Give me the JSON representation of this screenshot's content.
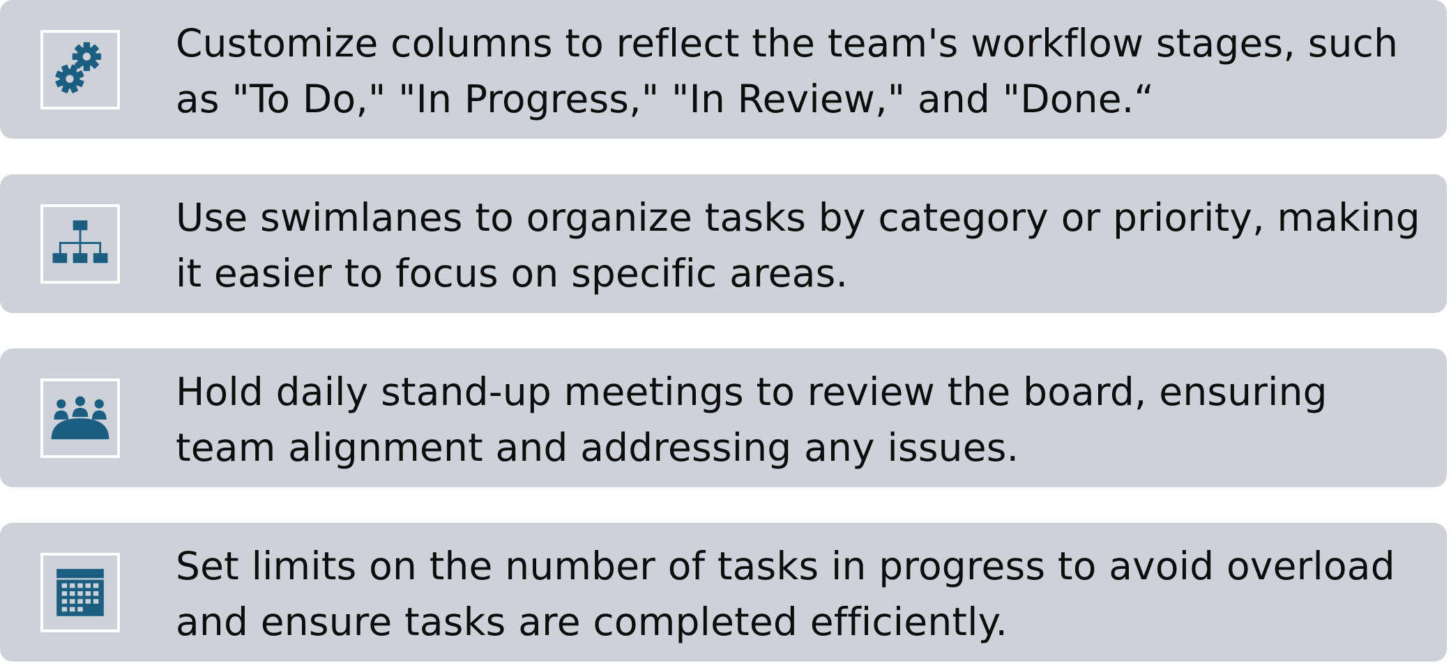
{
  "colors": {
    "card_background": "#cdd1d8",
    "icon_color": "#1b5e82",
    "icon_frame": "#ffffff",
    "text": "#0d0d0d"
  },
  "items": [
    {
      "icon": "gears-icon",
      "text": "Customize columns to reflect the team's workflow stages, such as \"To Do,\" \"In Progress,\" \"In Review,\" and \"Done.“"
    },
    {
      "icon": "hierarchy-icon",
      "text": "Use swimlanes to organize tasks by category or priority, making it easier to focus on specific areas."
    },
    {
      "icon": "meeting-icon",
      "text": "Hold daily stand-up meetings to review the board, ensuring team alignment and addressing any issues."
    },
    {
      "icon": "calendar-icon",
      "text": "Set limits on the number of tasks in progress to avoid overload and ensure tasks are completed efficiently."
    }
  ]
}
